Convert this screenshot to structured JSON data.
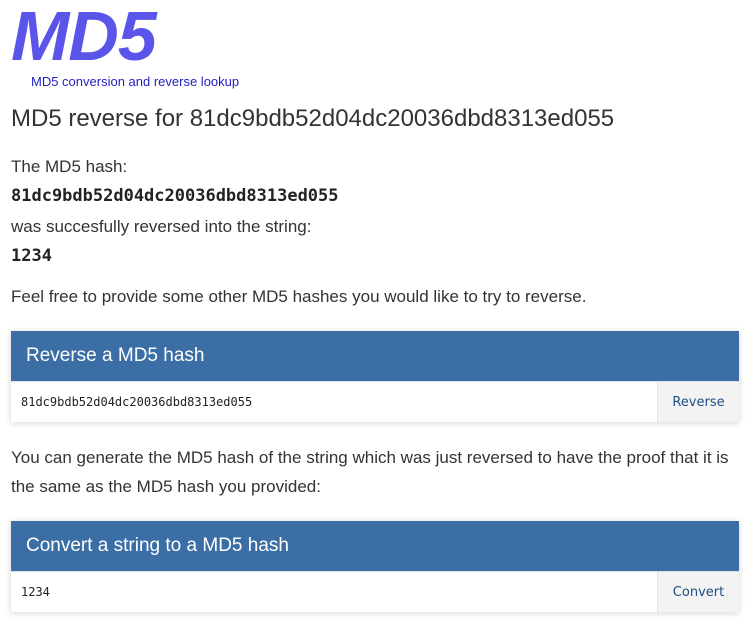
{
  "header": {
    "logo": "MD5",
    "tagline": "MD5 conversion and reverse lookup"
  },
  "main": {
    "title": "MD5 reverse for 81dc9bdb52d04dc20036dbd8313ed055",
    "hash_label": "The MD5 hash:",
    "hash_value": "81dc9bdb52d04dc20036dbd8313ed055",
    "reversed_label": "was succesfully reversed into the string:",
    "reversed_value": "1234",
    "invite_text": "Feel free to provide some other MD5 hashes you would like to try to reverse.",
    "proof_text_line1": "You can generate the MD5 hash of the string which was just reversed to have the proof that it is",
    "proof_text_line2": "the same as the MD5 hash you provided:"
  },
  "reverse_panel": {
    "title": "Reverse a MD5 hash",
    "input_value": "81dc9bdb52d04dc20036dbd8313ed055",
    "button_label": "Reverse"
  },
  "convert_panel": {
    "title": "Convert a string to a MD5 hash",
    "input_value": "1234",
    "button_label": "Convert"
  },
  "colors": {
    "logo": "#5a55e8",
    "tagline": "#1f1fc4",
    "panel_header": "#3a6ea5",
    "button_text": "#1d4f86"
  }
}
